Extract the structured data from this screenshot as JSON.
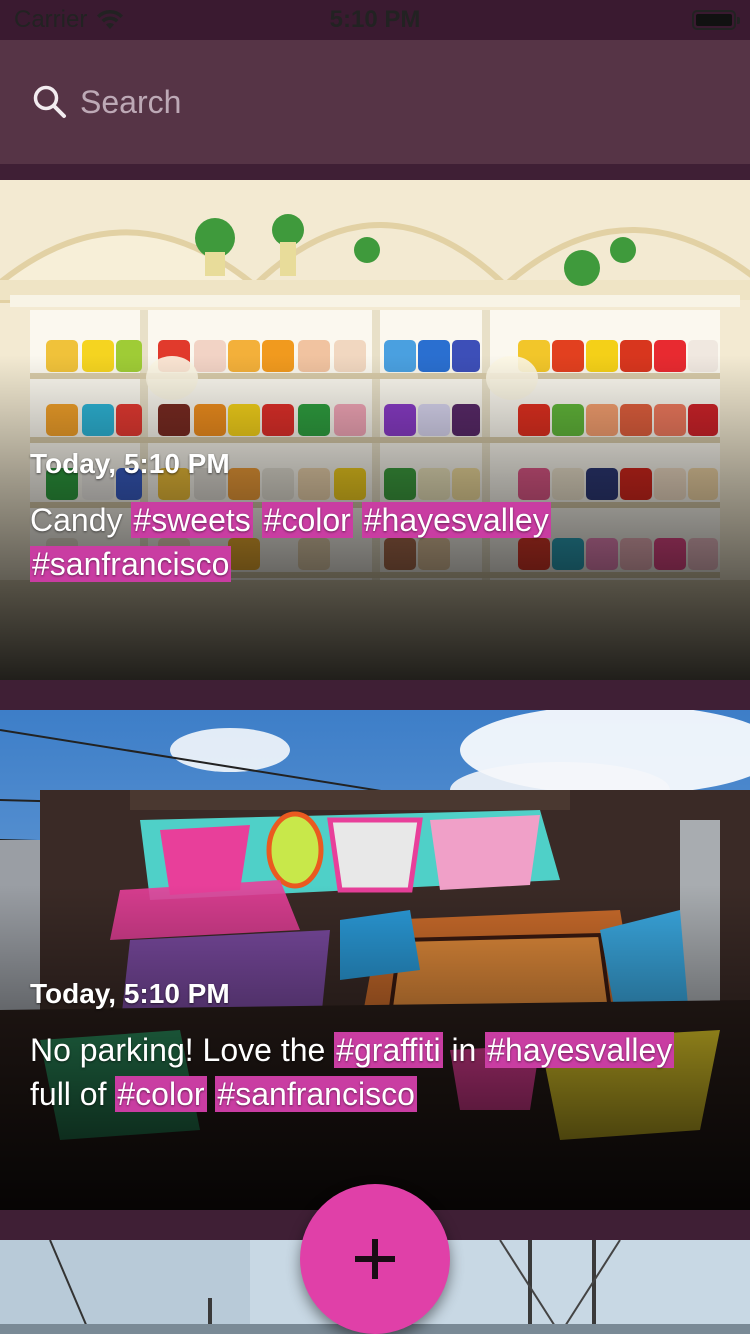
{
  "status_bar": {
    "carrier": "Carrier",
    "time": "5:10 PM",
    "battery_level": 1.0,
    "icons": [
      "wifi-icon",
      "battery-icon"
    ]
  },
  "search": {
    "placeholder": "Search",
    "icon": "search-icon"
  },
  "posts": [
    {
      "date": "Today, 5:10 PM",
      "caption": [
        {
          "text": "Candy "
        },
        {
          "text": "#sweets",
          "tag": true
        },
        {
          "text": " "
        },
        {
          "text": "#color",
          "tag": true
        },
        {
          "text": " "
        },
        {
          "text": "#hayesvalley",
          "tag": true
        },
        {
          "text": " "
        },
        {
          "text": "#sanfrancisco",
          "tag": true
        }
      ]
    },
    {
      "date": "Today, 5:10 PM",
      "caption": [
        {
          "text": "No parking! Love the "
        },
        {
          "text": "#graffiti",
          "tag": true
        },
        {
          "text": " in "
        },
        {
          "text": "#hayesvalley",
          "tag": true
        },
        {
          "text": " full of "
        },
        {
          "text": "#color",
          "tag": true
        },
        {
          "text": " "
        },
        {
          "text": "#sanfrancisco",
          "tag": true
        }
      ]
    }
  ],
  "fab": {
    "icon": "plus-icon"
  },
  "colors": {
    "background": "#3f1f35",
    "search_bar": "#563446",
    "hashtag": "#c93da2",
    "fab": "#e040a8"
  }
}
